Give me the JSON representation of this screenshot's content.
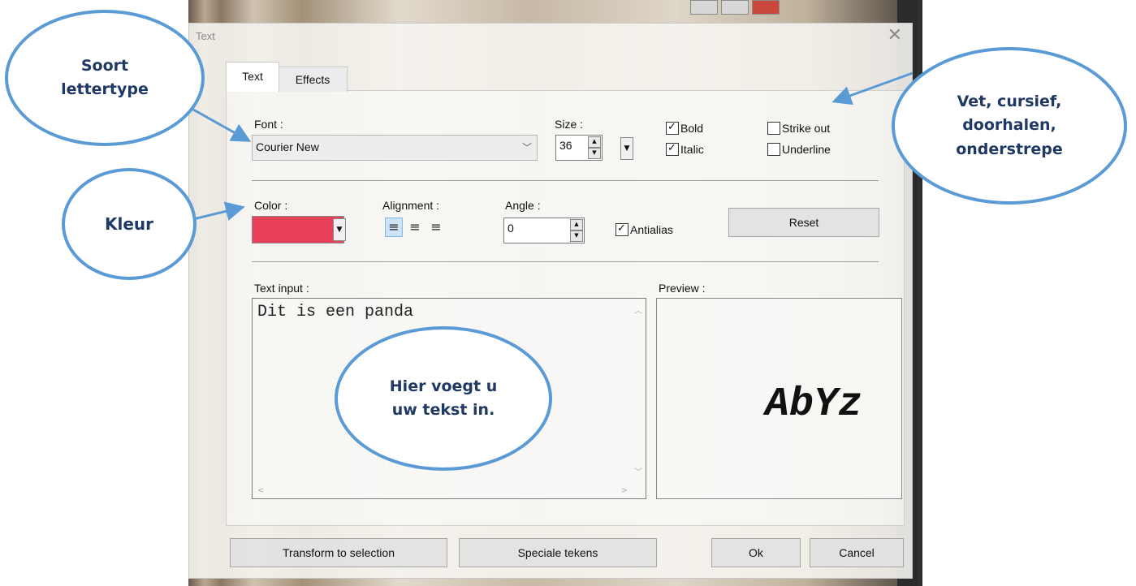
{
  "dialog": {
    "title": "Text",
    "close_icon": "close-icon",
    "tabs": [
      {
        "label": "Text",
        "active": true
      },
      {
        "label": "Effects",
        "active": false
      }
    ]
  },
  "font": {
    "label": "Font :",
    "value": "Courier New"
  },
  "size": {
    "label": "Size :",
    "value": "36"
  },
  "style_options": {
    "bold": {
      "label": "Bold",
      "checked": true
    },
    "italic": {
      "label": "Italic",
      "checked": true
    },
    "strike_out": {
      "label": "Strike out",
      "checked": false
    },
    "underline": {
      "label": "Underline",
      "checked": false
    }
  },
  "color": {
    "label": "Color :",
    "value": "#e94159"
  },
  "alignment": {
    "label": "Alignment :",
    "selected": "left",
    "icons": [
      "align-left-icon",
      "align-center-icon",
      "align-right-icon"
    ]
  },
  "angle": {
    "label": "Angle :",
    "value": "0"
  },
  "antialias": {
    "label": "Antialias",
    "checked": true
  },
  "reset_label": "Reset",
  "text_input": {
    "label": "Text input :",
    "value": "Dit is een panda"
  },
  "preview": {
    "label": "Preview :",
    "sample": "AbYz"
  },
  "buttons": {
    "transform": "Transform to selection",
    "special": "Speciale tekens",
    "ok": "Ok",
    "cancel": "Cancel"
  },
  "annotations": {
    "font_type": [
      "Soort",
      "lettertype"
    ],
    "color": "Kleur",
    "styles": [
      "Vet, cursief,",
      "doorhalen,",
      "onderstrepe"
    ],
    "text_hint": [
      "Hier voegt u",
      "uw tekst in."
    ]
  },
  "colors": {
    "accent": "#5b9bd5",
    "annotation_text": "#1f3864"
  }
}
